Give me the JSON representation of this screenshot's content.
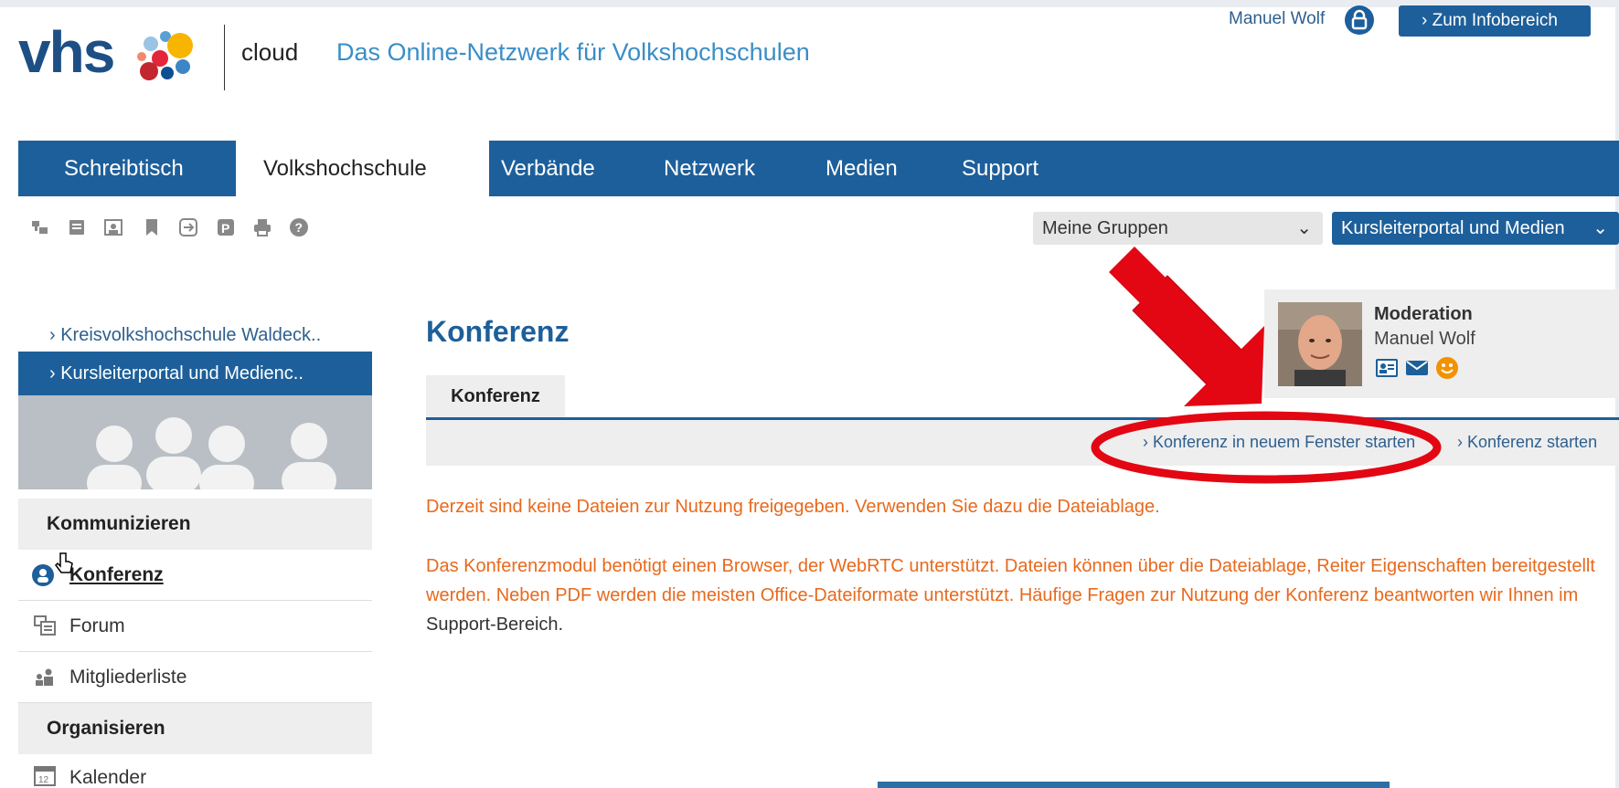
{
  "header": {
    "logo_text": "vhs",
    "logo_sub": "cloud",
    "tagline": "Das Online-Netzwerk für Volkshochschulen",
    "user_name": "Manuel Wolf",
    "info_button": "› Zum Infobereich"
  },
  "nav": {
    "tabs": [
      {
        "label": "Schreibtisch"
      },
      {
        "label": "Volkshochschule"
      },
      {
        "label": "Verbände"
      },
      {
        "label": "Netzwerk"
      },
      {
        "label": "Medien"
      },
      {
        "label": "Support"
      }
    ],
    "active_tab": "Volkshochschule"
  },
  "toolbar": {
    "icons": [
      "copy-icon",
      "notes-icon",
      "group-photo-icon",
      "bookmark-icon",
      "exit-icon",
      "parking-icon",
      "print-icon",
      "help-icon"
    ],
    "groups_select": "Meine Gruppen",
    "portal_select": "Kursleiterportal und Medien"
  },
  "sidebar": {
    "links": [
      {
        "label": "› Kreisvolkshochschule Waldeck.."
      },
      {
        "label": "› Kursleiterportal und Medienc.."
      }
    ],
    "section_communicate": "Kommunizieren",
    "communicate_items": [
      {
        "label": "Konferenz"
      },
      {
        "label": "Forum"
      },
      {
        "label": "Mitgliederliste"
      }
    ],
    "section_organize": "Organisieren",
    "organize_items": [
      {
        "label": "Kalender"
      }
    ]
  },
  "main": {
    "title": "Konferenz",
    "subtab": "Konferenz",
    "action_new_window": "› Konferenz in neuem Fenster starten",
    "action_start": "› Konferenz starten",
    "message_no_files": "Derzeit sind keine Dateien zur Nutzung freigegeben. Verwenden Sie dazu die Dateiablage.",
    "message_info": "Das Konferenzmodul benötigt einen Browser, der WebRTC unterstützt. Dateien können über die Dateiablage, Reiter Eigenschaften bereitgestellt werden. Neben PDF werden die meisten Office-Dateiformate unterstützt. Häufige Fragen zur Nutzung der Konferenz beantworten wir Ihnen im",
    "support_link": "Support-Bereich",
    "support_suffix": "."
  },
  "moderation": {
    "title": "Moderation",
    "name": "Manuel Wolf"
  },
  "colors": {
    "brand_blue": "#1d5f9a",
    "text_orange": "#e8691c",
    "annotation_red": "#e30613"
  }
}
